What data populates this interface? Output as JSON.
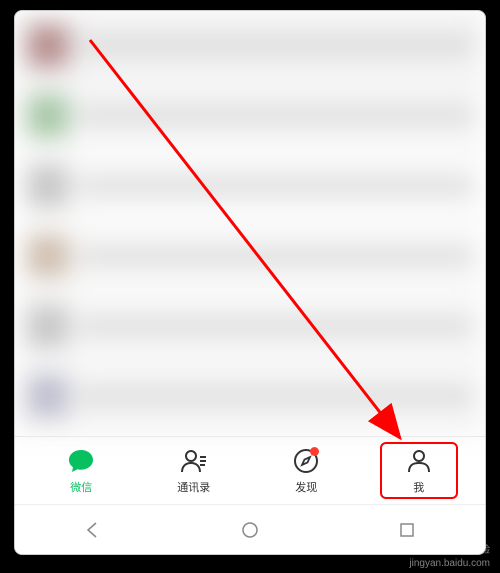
{
  "tabs": [
    {
      "label": "微信",
      "icon": "chat-bubble-icon",
      "active": true,
      "badge": false
    },
    {
      "label": "通讯录",
      "icon": "contacts-icon",
      "active": false,
      "badge": false
    },
    {
      "label": "发现",
      "icon": "discover-icon",
      "active": false,
      "badge": true
    },
    {
      "label": "我",
      "icon": "me-icon",
      "active": false,
      "badge": false,
      "highlighted": true
    }
  ],
  "watermark": {
    "brand": "Baidu 经验",
    "url": "jingyan.baidu.com"
  },
  "colors": {
    "active": "#07c160",
    "inactive": "#333333",
    "highlight": "#ff0000",
    "badge": "#ff3b30"
  }
}
